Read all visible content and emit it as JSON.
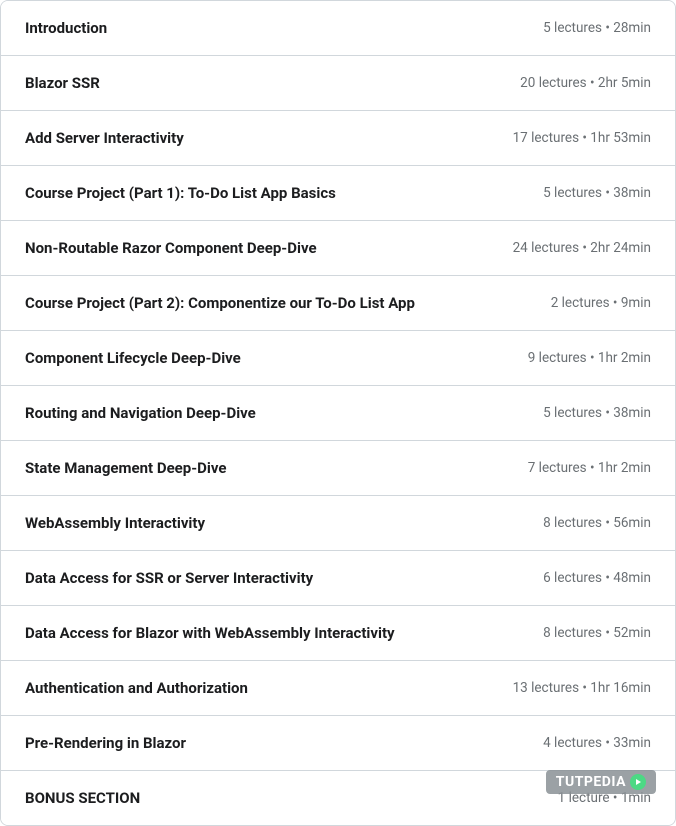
{
  "sections": [
    {
      "title": "Introduction",
      "meta": "5 lectures • 28min"
    },
    {
      "title": "Blazor SSR",
      "meta": "20 lectures • 2hr 5min"
    },
    {
      "title": "Add Server Interactivity",
      "meta": "17 lectures • 1hr 53min"
    },
    {
      "title": "Course Project (Part 1): To-Do List App Basics",
      "meta": "5 lectures • 38min"
    },
    {
      "title": "Non-Routable Razor Component Deep-Dive",
      "meta": "24 lectures • 2hr 24min"
    },
    {
      "title": "Course Project (Part 2): Componentize our To-Do List App",
      "meta": "2 lectures • 9min"
    },
    {
      "title": "Component Lifecycle Deep-Dive",
      "meta": "9 lectures • 1hr 2min"
    },
    {
      "title": "Routing and Navigation Deep-Dive",
      "meta": "5 lectures • 38min"
    },
    {
      "title": "State Management Deep-Dive",
      "meta": "7 lectures • 1hr 2min"
    },
    {
      "title": "WebAssembly Interactivity",
      "meta": "8 lectures • 56min"
    },
    {
      "title": "Data Access for SSR or Server Interactivity",
      "meta": "6 lectures • 48min"
    },
    {
      "title": "Data Access for Blazor with WebAssembly Interactivity",
      "meta": "8 lectures • 52min"
    },
    {
      "title": "Authentication and Authorization",
      "meta": "13 lectures • 1hr 16min"
    },
    {
      "title": "Pre-Rendering in Blazor",
      "meta": "4 lectures • 33min"
    },
    {
      "title": "BONUS SECTION",
      "meta": "1 lecture • 1min"
    }
  ],
  "watermark": {
    "text": "TUTPEDIA"
  }
}
